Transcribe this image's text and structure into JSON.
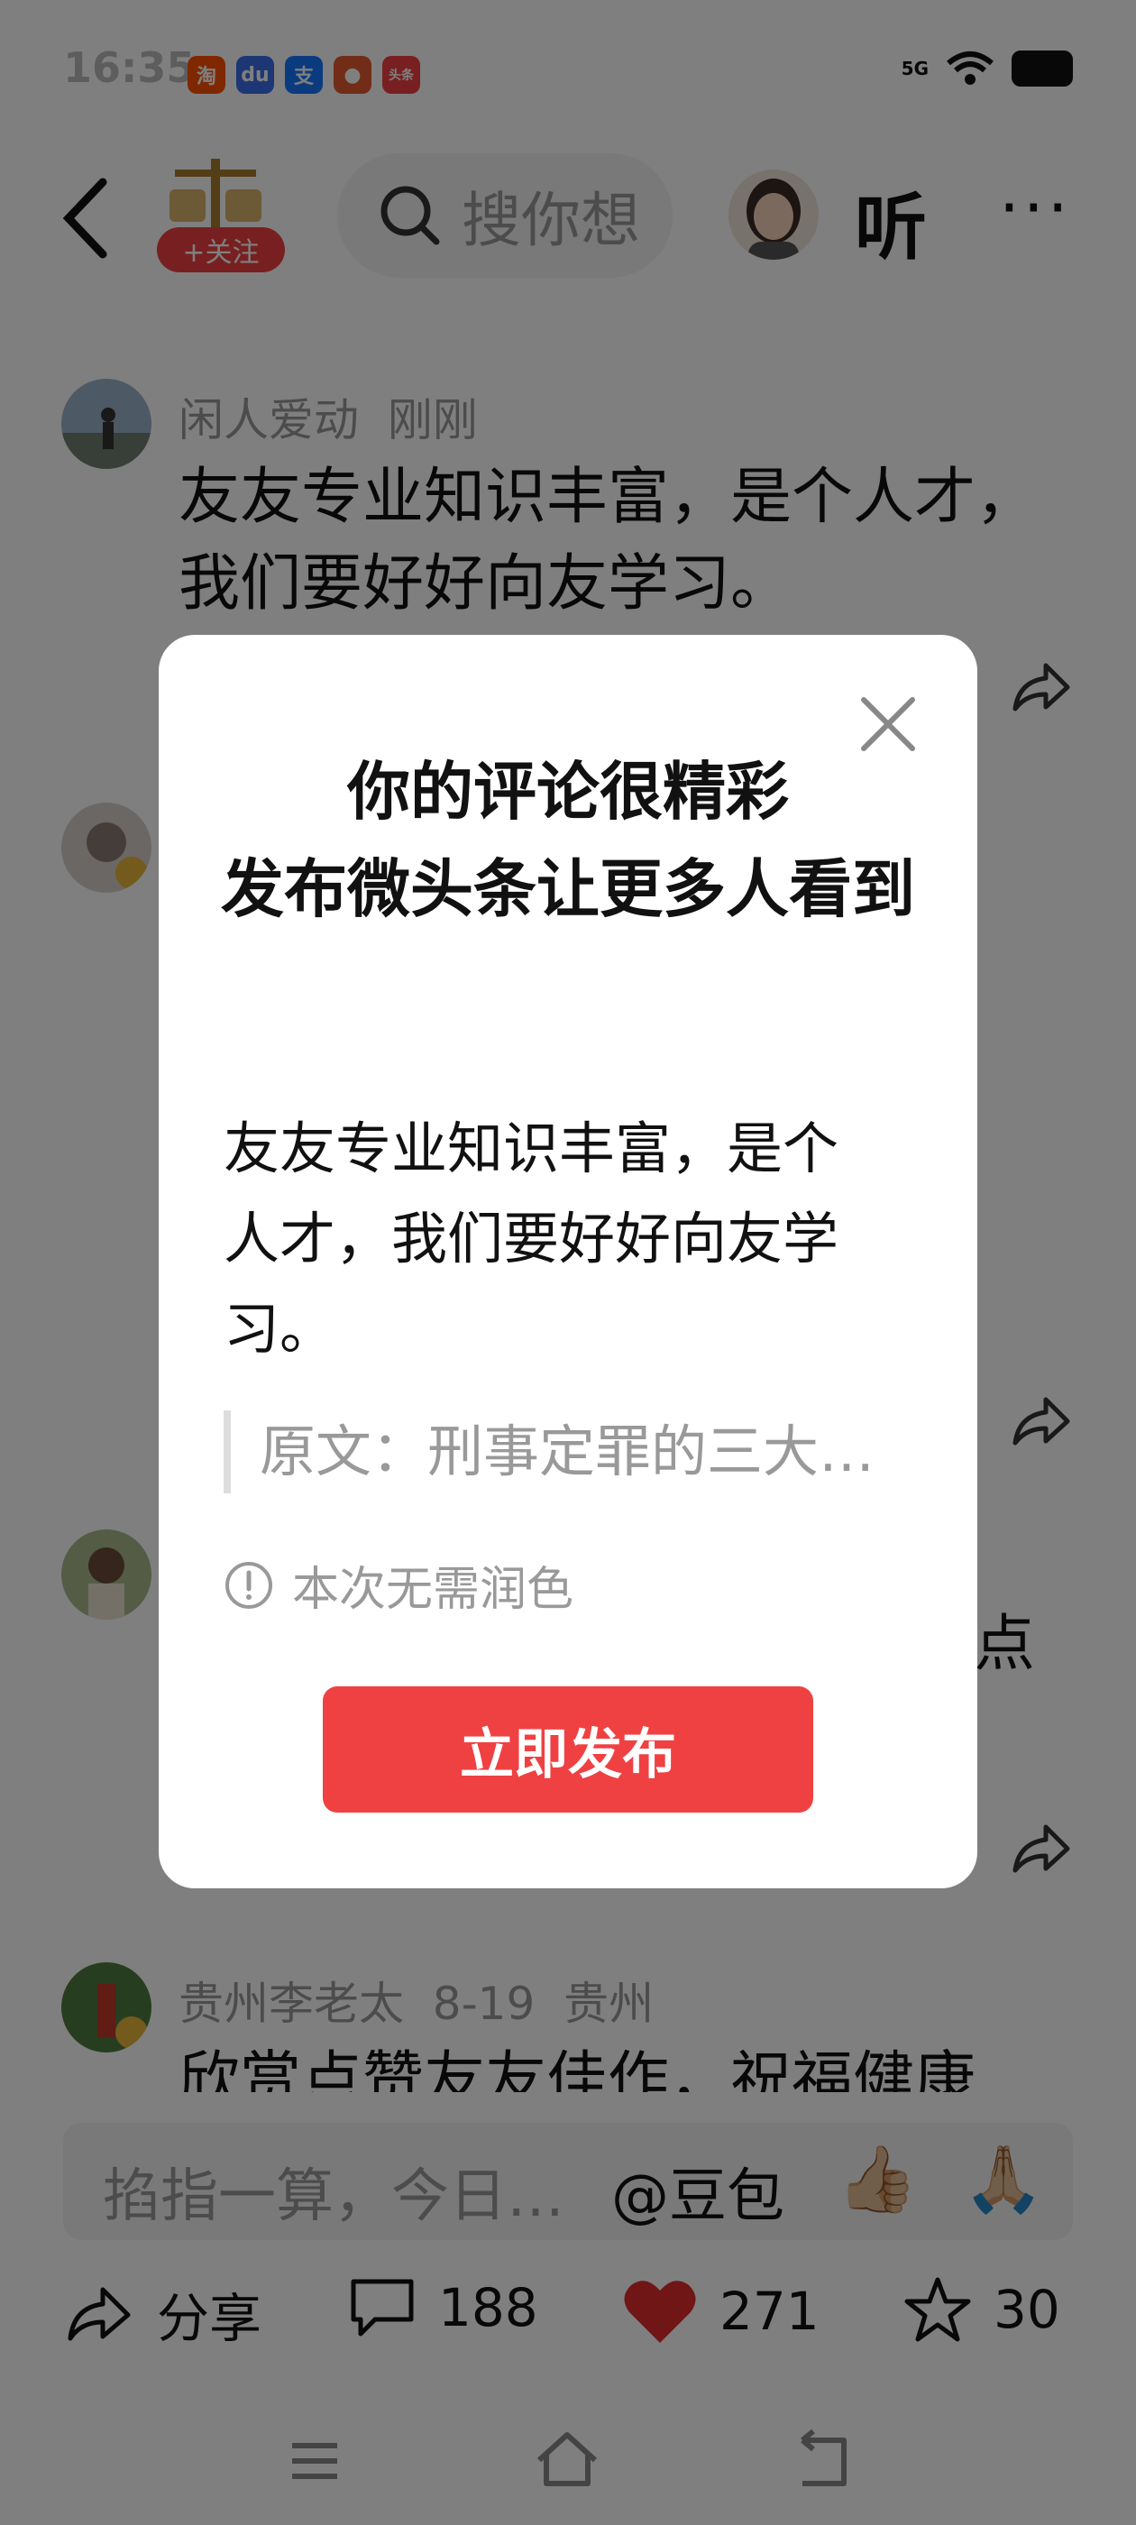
{
  "status_bar": {
    "time": "16:35",
    "signal": "5G",
    "apps": [
      {
        "icon": "taobao-icon",
        "label": "淘",
        "color": "#ff5000"
      },
      {
        "icon": "baidu-icon",
        "label": "du",
        "color": "#3b6fe8"
      },
      {
        "icon": "alipay-icon",
        "label": "支",
        "color": "#1677ff"
      },
      {
        "icon": "game-icon",
        "label": "●",
        "color": "#e35b2e"
      },
      {
        "icon": "toutiao-icon",
        "label": "头条",
        "color": "#f04142"
      }
    ]
  },
  "header": {
    "follow_label": "+关注",
    "search_placeholder": "搜你想",
    "listen_label": "听",
    "more_label": "···"
  },
  "comments": [
    {
      "author": "闲人爱动",
      "time": "刚刚",
      "location": "",
      "text": "友友专业知识丰富，是个人才，我们要好好向友学习。"
    },
    {
      "author": "",
      "time": "",
      "location": "",
      "text": ""
    },
    {
      "author": "",
      "time": "",
      "location": "",
      "text": "点"
    },
    {
      "author": "贵州李老太",
      "time": "8-19",
      "location": "贵州",
      "text": "欣赏点赞友友佳作，祝福健康"
    }
  ],
  "input_bar": {
    "placeholder": "掐指一算，今日…",
    "at_label": "@豆包",
    "emoji_1": "👍🏼",
    "emoji_2": "🙏🏼"
  },
  "actions": {
    "share_label": "分享",
    "comment_count": "188",
    "like_count": "271",
    "fav_count": "30",
    "like_color": "#e02d2d"
  },
  "dialog": {
    "title_line1": "你的评论很精彩",
    "title_line2": "发布微头条让更多人看到",
    "body": "友友专业知识丰富，是个人才，我们要好好向友学习。",
    "quote": "原文：刑事定罪的三大…",
    "note": "本次无需润色",
    "publish_label": "立即发布",
    "accent": "#f04142"
  }
}
